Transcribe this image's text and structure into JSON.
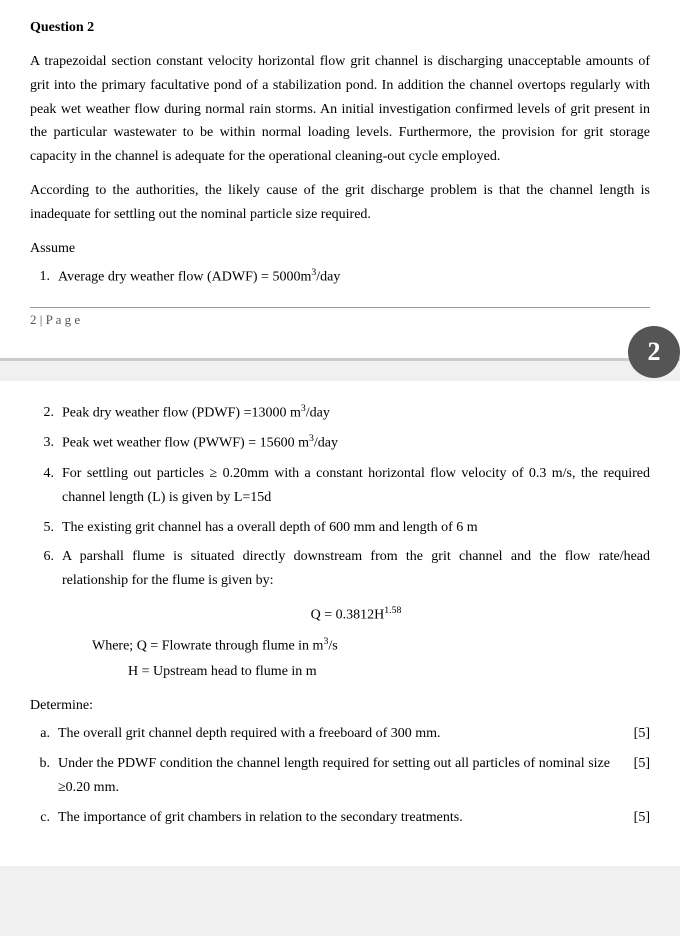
{
  "page": {
    "top": {
      "question_title": "Question 2",
      "body_para1": "A trapezoidal section constant velocity horizontal flow grit channel is discharging unacceptable amounts of grit into the primary facultative pond of a stabilization pond. In addition the channel overtops regularly with peak wet weather flow during normal rain storms. An initial investigation confirmed levels of grit present in the particular wastewater to be within normal loading levels. Furthermore, the provision for grit storage capacity in the channel is adequate for the operational cleaning-out cycle employed.",
      "body_para2": "According to the authorities, the likely cause of the grit discharge problem is that the channel length is inadequate for settling out the nominal particle size required.",
      "assume_label": "Assume",
      "list_items": [
        {
          "num": "1.",
          "text_before": "Average dry weather flow (ADWF) = 5000m",
          "sup": "3",
          "text_after": "/day"
        }
      ],
      "footer_text": "2 | P a g e",
      "badge": "2"
    },
    "bottom": {
      "list_items": [
        {
          "num": "2.",
          "text_before": "Peak dry weather flow (PDWF) =13000 m",
          "sup": "3",
          "text_after": "/day"
        },
        {
          "num": "3.",
          "text_before": "Peak wet weather flow (PWWF) = 15600 m",
          "sup": "3",
          "text_after": "/day"
        },
        {
          "num": "4.",
          "text": "For settling out particles ≥ 0.20mm with a constant horizontal flow velocity of 0.3 m/s, the required channel length (L) is given by L=15d"
        },
        {
          "num": "5.",
          "text": "The existing grit channel has a overall depth of 600 mm and length of 6 m"
        },
        {
          "num": "6.",
          "text_before": "A parshall flume is situated directly downstream from the grit channel and the flow rate/head relationship for the flume is given by:",
          "formula": "Q = 0.3812H",
          "formula_sup": "1.58",
          "where_lines": [
            "Where; Q = Flowrate through flume in m³/s",
            "H = Upstream head to flume in m"
          ]
        }
      ],
      "determine_label": "Determine:",
      "alpha_items": [
        {
          "label": "a.",
          "text": "The overall grit channel depth required with a freeboard of 300 mm.",
          "score": "[5]"
        },
        {
          "label": "b.",
          "text": "Under the PDWF condition the channel length required for setting out all particles of nominal size ≥0.20 mm.",
          "score": "[5]"
        },
        {
          "label": "c.",
          "text": "The importance of grit chambers in relation to the secondary treatments.",
          "score": "[5]"
        }
      ]
    }
  }
}
